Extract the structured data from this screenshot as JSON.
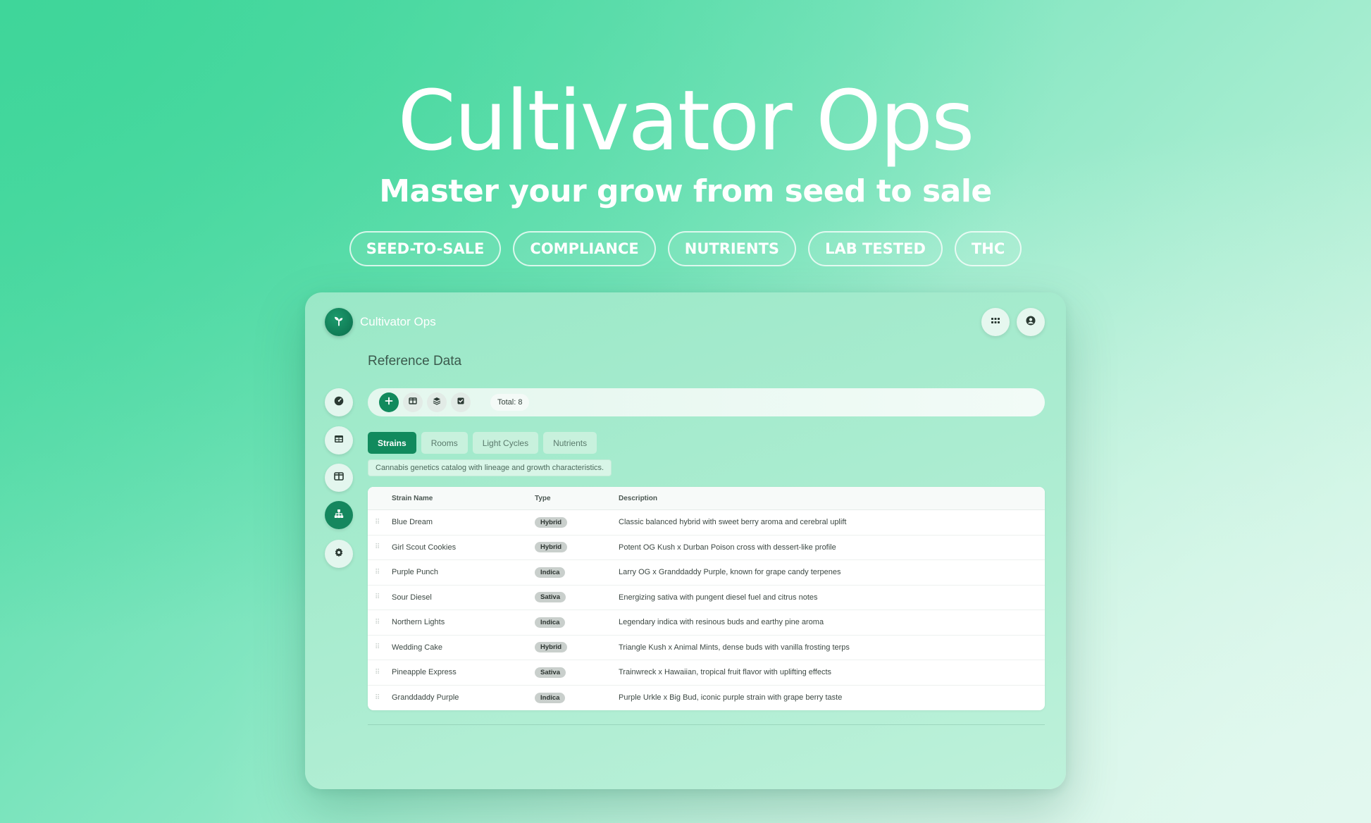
{
  "hero": {
    "title": "Cultivator Ops",
    "subtitle": "Master your grow from seed to sale",
    "pills": [
      "SEED-TO-SALE",
      "COMPLIANCE",
      "NUTRIENTS",
      "LAB TESTED",
      "THC"
    ]
  },
  "app": {
    "name": "Cultivator Ops",
    "page_title": "Reference Data",
    "header_icons": [
      "apps-grid-icon",
      "account-icon"
    ],
    "sidebar_icons": [
      "dashboard-icon",
      "table-icon",
      "layout-icon",
      "hierarchy-icon",
      "settings-icon"
    ],
    "active_sidebar_index": 3
  },
  "toolbar": {
    "icons": [
      "add-icon",
      "columns-icon",
      "layers-icon",
      "checkbox-icon"
    ],
    "total_label": "Total:",
    "total_value": "8"
  },
  "tabs": [
    "Strains",
    "Rooms",
    "Light Cycles",
    "Nutrients"
  ],
  "active_tab": "Strains",
  "tab_description": "Cannabis genetics catalog with lineage and growth characteristics.",
  "table": {
    "columns": [
      "Strain Name",
      "Type",
      "Description"
    ],
    "rows": [
      {
        "name": "Blue Dream",
        "type": "Hybrid",
        "description": "Classic balanced hybrid with sweet berry aroma and cerebral uplift"
      },
      {
        "name": "Girl Scout Cookies",
        "type": "Hybrid",
        "description": "Potent OG Kush x Durban Poison cross with dessert-like profile"
      },
      {
        "name": "Purple Punch",
        "type": "Indica",
        "description": "Larry OG x Granddaddy Purple, known for grape candy terpenes"
      },
      {
        "name": "Sour Diesel",
        "type": "Sativa",
        "description": "Energizing sativa with pungent diesel fuel and citrus notes"
      },
      {
        "name": "Northern Lights",
        "type": "Indica",
        "description": "Legendary indica with resinous buds and earthy pine aroma"
      },
      {
        "name": "Wedding Cake",
        "type": "Hybrid",
        "description": "Triangle Kush x Animal Mints, dense buds with vanilla frosting terps"
      },
      {
        "name": "Pineapple Express",
        "type": "Sativa",
        "description": "Trainwreck x Hawaiian, tropical fruit flavor with uplifting effects"
      },
      {
        "name": "Granddaddy Purple",
        "type": "Indica",
        "description": "Purple Urkle x Big Bud, iconic purple strain with grape berry taste"
      }
    ]
  },
  "colors": {
    "accent": "#118a5d",
    "badge_bg": "#c9cfcc"
  }
}
